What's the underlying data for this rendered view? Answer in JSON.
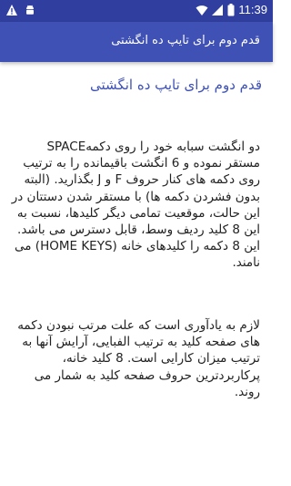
{
  "status_bar": {
    "time": "11:39",
    "notification_icons": [
      "warning-icon",
      "android-icon"
    ],
    "system_icons": [
      "wifi-icon",
      "signal-icon",
      "battery-icon"
    ]
  },
  "app_bar": {
    "title": "قدم دوم برای تایپ ده انگشتی",
    "color": "#3f51b5"
  },
  "content": {
    "heading": "قدم دوم برای تایپ ده انگشتی",
    "paragraph_1": "دو انگشت سبابه خود را روی دکمهSPACE مستقر نموده و 6 انگشت باقیمانده را به ترتیب روی دکمه های کنار حروف F و J بگذارید. (البته بدون فشردن دکمه ها) با مستقر شدن دستتان در این حالت، موقعیت تمامی دیگر کلیدها، نسبت به این 8 کلید ردیف وسط، قابل دسترس می باشد. این 8 دکمه را کلیدهای خانه (HOME KEYS) می نامند.",
    "paragraph_2": "لازم به یادآوری است که علت مرتب نبودن دکمه های صفحه کلید به ترتیب الفبایی، آرایش آنها به ترتیب میزان کارایی است. 8 کلید خانه، پرکاربردترین حروف صفحه کلید به شمار می روند."
  }
}
